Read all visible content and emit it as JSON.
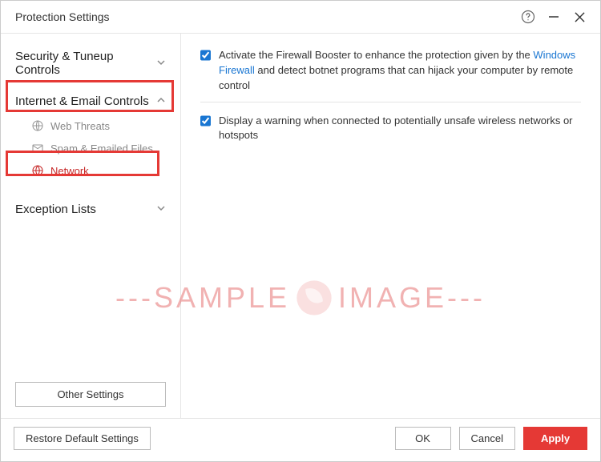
{
  "titlebar": {
    "title": "Protection Settings"
  },
  "sidebar": {
    "items": [
      {
        "label": "Security & Tuneup Controls",
        "expanded": false
      },
      {
        "label": "Internet & Email Controls",
        "expanded": true
      },
      {
        "label": "Exception Lists",
        "expanded": false
      }
    ],
    "sub": {
      "web_threats": "Web Threats",
      "spam": "Spam & Emailed Files",
      "network": "Network"
    },
    "other_settings": "Other Settings"
  },
  "main": {
    "opt1_pre": "Activate the Firewall Booster to enhance the protection given by the ",
    "opt1_link": "Windows Firewall",
    "opt1_post": " and detect botnet programs that can hijack your computer by remote control",
    "opt2": "Display a warning when connected to potentially unsafe wireless networks or hotspots"
  },
  "bottom": {
    "restore": "Restore Default Settings",
    "ok": "OK",
    "cancel": "Cancel",
    "apply": "Apply"
  },
  "watermark": {
    "left": "---SAMPLE",
    "right": "IMAGE---"
  }
}
